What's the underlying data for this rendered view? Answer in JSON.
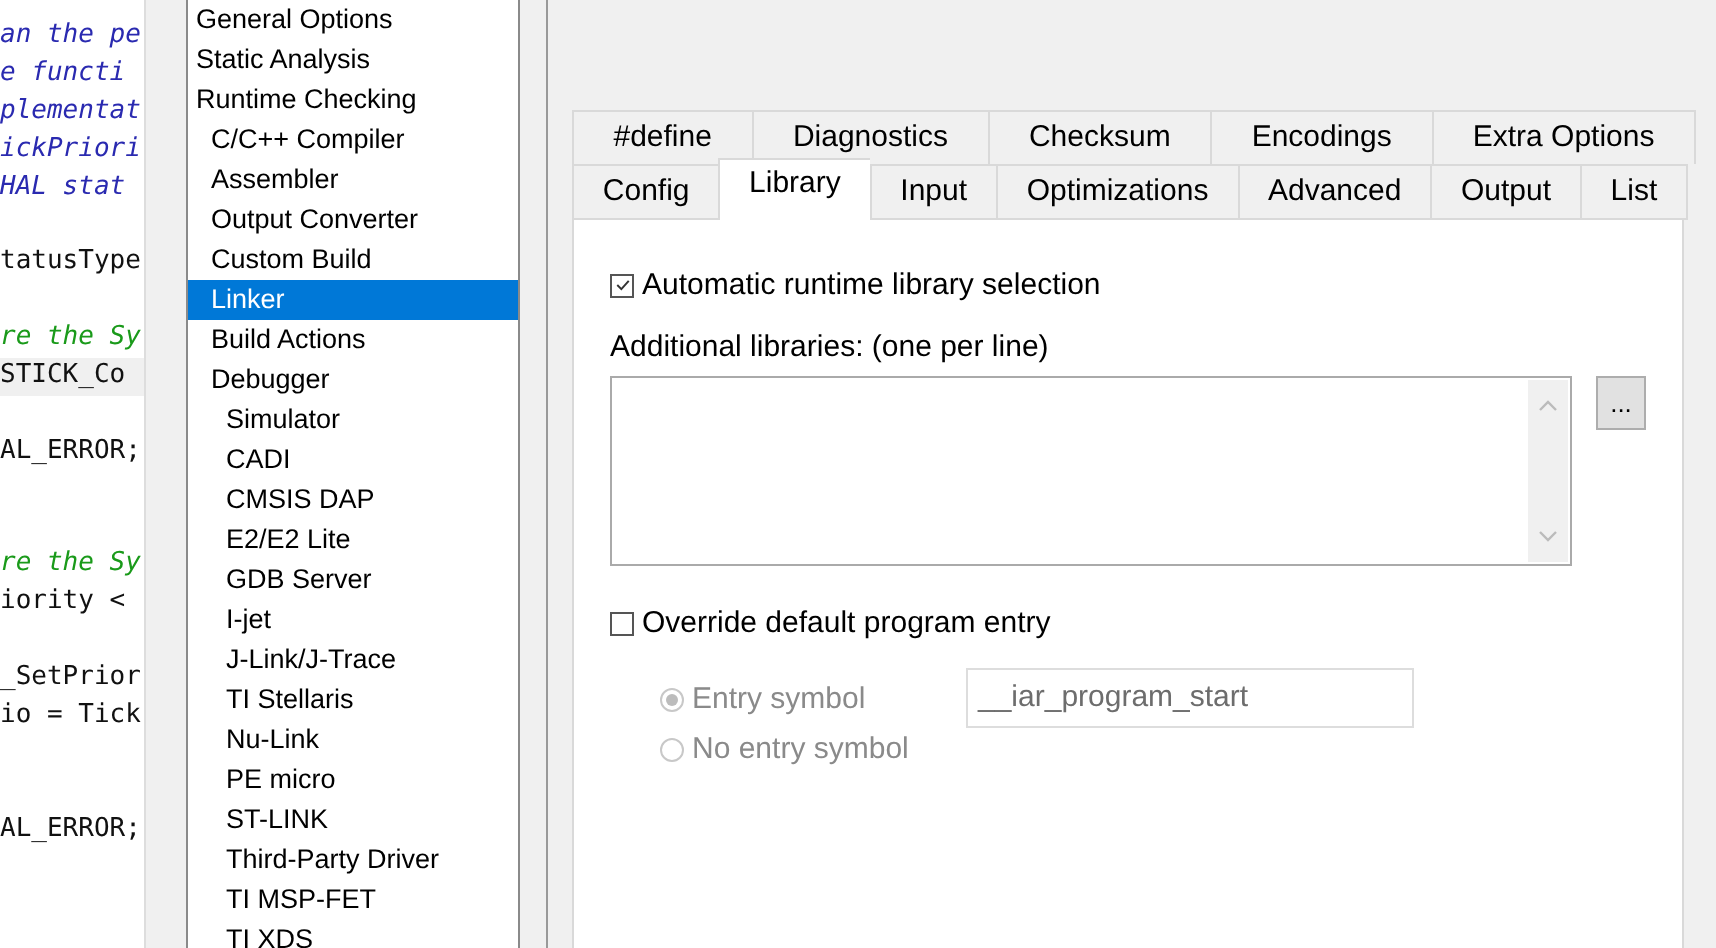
{
  "editor": {
    "lines": [
      {
        "text": "an the pe",
        "kind": "doc-comment",
        "highlighted": false
      },
      {
        "text": "e functi",
        "kind": "doc-comment",
        "highlighted": false
      },
      {
        "text": "plementat",
        "kind": "doc-comment",
        "highlighted": false
      },
      {
        "text": "ickPriori",
        "kind": "doc-comment",
        "highlighted": false
      },
      {
        "text": "HAL stat",
        "kind": "doc-comment",
        "highlighted": false
      },
      {
        "kind": "code",
        "highlighted": false
      },
      {
        "text": "tatusType",
        "kind": "code",
        "highlighted": false
      },
      {
        "kind": "code",
        "highlighted": false
      },
      {
        "text": "re the Sy",
        "kind": "comment",
        "highlighted": false
      },
      {
        "text": "STICK_Co",
        "kind": "code",
        "highlighted": true
      },
      {
        "kind": "code",
        "highlighted": false
      },
      {
        "text": "AL_ERROR;",
        "kind": "code",
        "highlighted": false
      },
      {
        "kind": "code",
        "highlighted": false
      },
      {
        "kind": "code",
        "highlighted": false
      },
      {
        "text": "re the Sy",
        "kind": "comment",
        "highlighted": false
      },
      {
        "text": "iority <",
        "kind": "code",
        "highlighted": false
      },
      {
        "kind": "code",
        "highlighted": false
      },
      {
        "text": "_SetPrior",
        "kind": "code",
        "highlighted": false
      },
      {
        "text": "io = Tick",
        "kind": "code",
        "highlighted": false
      },
      {
        "kind": "code",
        "highlighted": false
      },
      {
        "kind": "code",
        "highlighted": false
      },
      {
        "text": "AL_ERROR;",
        "kind": "code",
        "highlighted": false
      }
    ]
  },
  "categories": [
    {
      "label": "General Options",
      "selected": false
    },
    {
      "label": "Static Analysis",
      "selected": false
    },
    {
      "label": "Runtime Checking",
      "selected": false,
      "children": [
        {
          "label": "C/C++ Compiler",
          "selected": false
        },
        {
          "label": "Assembler",
          "selected": false
        },
        {
          "label": "Output Converter",
          "selected": false
        },
        {
          "label": "Custom Build",
          "selected": false
        },
        {
          "label": "Linker",
          "selected": true
        },
        {
          "label": "Build Actions",
          "selected": false
        },
        {
          "label": "Debugger",
          "selected": false,
          "children": [
            {
              "label": "Simulator",
              "selected": false
            },
            {
              "label": "CADI",
              "selected": false
            },
            {
              "label": "CMSIS DAP",
              "selected": false
            },
            {
              "label": "E2/E2 Lite",
              "selected": false
            },
            {
              "label": "GDB Server",
              "selected": false
            },
            {
              "label": "I-jet",
              "selected": false
            },
            {
              "label": "J-Link/J-Trace",
              "selected": false
            },
            {
              "label": "TI Stellaris",
              "selected": false
            },
            {
              "label": "Nu-Link",
              "selected": false
            },
            {
              "label": "PE micro",
              "selected": false
            },
            {
              "label": "ST-LINK",
              "selected": false
            },
            {
              "label": "Third-Party Driver",
              "selected": false
            },
            {
              "label": "TI MSP-FET",
              "selected": false
            },
            {
              "label": "TI XDS",
              "selected": false
            }
          ]
        }
      ]
    }
  ],
  "tab_rows": [
    [
      {
        "label": "#define",
        "selected": false
      },
      {
        "label": "Diagnostics",
        "selected": false
      },
      {
        "label": "Checksum",
        "selected": false
      },
      {
        "label": "Encodings",
        "selected": false
      },
      {
        "label": "Extra Options",
        "selected": false
      }
    ],
    [
      {
        "label": "Config",
        "selected": false
      },
      {
        "label": "Library",
        "selected": true
      },
      {
        "label": "Input",
        "selected": false
      },
      {
        "label": "Optimizations",
        "selected": false
      },
      {
        "label": "Advanced",
        "selected": false
      },
      {
        "label": "Output",
        "selected": false
      },
      {
        "label": "List",
        "selected": false
      }
    ]
  ],
  "library": {
    "auto_runtime": {
      "label": "Automatic runtime library selection",
      "checked": true
    },
    "additional_label": "Additional libraries: (one per line)",
    "browse_button": "...",
    "override_entry": {
      "label": "Override default program entry",
      "checked": false
    },
    "entry_options": [
      {
        "label": "Entry symbol",
        "selected": true,
        "disabled": true
      },
      {
        "label": "No entry symbol",
        "selected": false,
        "disabled": true
      }
    ],
    "entry_symbol": {
      "value": "__iar_program_start",
      "disabled": true
    }
  }
}
